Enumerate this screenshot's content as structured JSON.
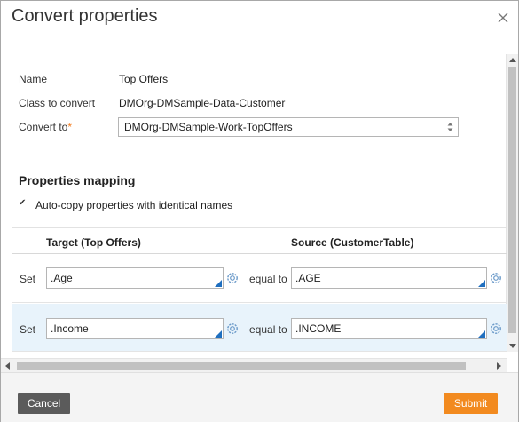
{
  "dialog": {
    "title": "Convert properties"
  },
  "fields": {
    "name_label": "Name",
    "name_value": "Top Offers",
    "class_label": "Class to convert",
    "class_value": "DMOrg-DMSample-Data-Customer",
    "convert_label": "Convert to",
    "convert_required": "*",
    "convert_value": "DMOrg-DMSample-Work-TopOffers"
  },
  "mapping": {
    "section_title": "Properties mapping",
    "autocopy_checked": true,
    "autocopy_label": "Auto-copy properties with identical names",
    "target_header": "Target (Top Offers)",
    "source_header": "Source (CustomerTable)",
    "rows": [
      {
        "set_label": "Set",
        "target": ".Age",
        "equal_label": "equal to",
        "source": ".AGE",
        "highlighted": false
      },
      {
        "set_label": "Set",
        "target": ".Income",
        "equal_label": "equal to",
        "source": ".INCOME",
        "highlighted": true
      }
    ]
  },
  "footer": {
    "cancel_label": "Cancel",
    "submit_label": "Submit"
  },
  "colors": {
    "submit": "#f28a1f",
    "cancel": "#5b5b5b",
    "row_highlight": "#e8f3fb",
    "required_star": "#f27c1f"
  }
}
